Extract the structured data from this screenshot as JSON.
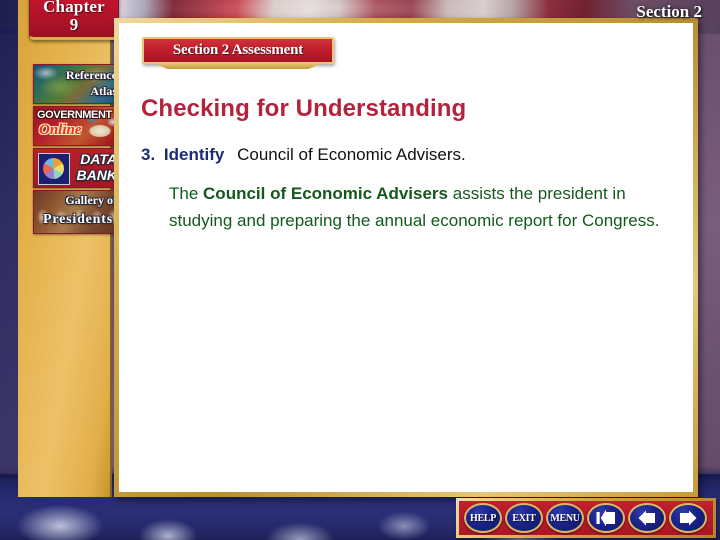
{
  "slide": {
    "chapter": {
      "word": "Chapter",
      "number": "9"
    },
    "section_label": "Section 2"
  },
  "sidebar": {
    "buttons": [
      {
        "name": "reference-atlas",
        "line1": "Reference",
        "line2": "Atlas"
      },
      {
        "name": "government-online",
        "line1": "GOVERNMENT",
        "line2": "Online"
      },
      {
        "name": "data-bank",
        "line1": "DATA",
        "line2": "BANK"
      },
      {
        "name": "gallery-presidents",
        "line1": "Gallery of",
        "line2": "Presidents"
      }
    ]
  },
  "content": {
    "assessment_banner": "Section 2 Assessment",
    "heading": "Checking for Understanding",
    "question": {
      "number": "3.",
      "verb": "Identify",
      "rest": "Council of Economic Advisers."
    },
    "answer": {
      "prefix": "The ",
      "bold": "Council of Economic Advisers",
      "suffix": " assists the president in studying and preparing the annual economic report for Congress."
    }
  },
  "navbar": {
    "buttons": [
      {
        "name": "help-button",
        "label": "HELP",
        "icon": "text"
      },
      {
        "name": "exit-button",
        "label": "EXIT",
        "icon": "text"
      },
      {
        "name": "menu-button",
        "label": "MENU",
        "icon": "text"
      },
      {
        "name": "first-slide-button",
        "label": "",
        "icon": "first-slide-icon"
      },
      {
        "name": "previous-slide-button",
        "label": "",
        "icon": "arrow-left-icon"
      },
      {
        "name": "next-slide-button",
        "label": "",
        "icon": "arrow-right-icon"
      }
    ]
  },
  "colors": {
    "accent_red": "#b5223c",
    "banner_red": "#c01f2c",
    "question_blue": "#1c2a78",
    "answer_green": "#14591c",
    "gold": "#d6ab46",
    "navy": "#1a2288"
  }
}
